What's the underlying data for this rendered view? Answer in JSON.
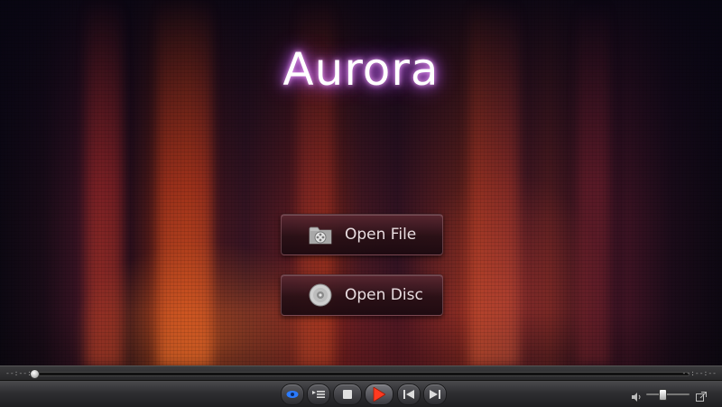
{
  "app": {
    "logo_text": "Aurora"
  },
  "main": {
    "open_file": {
      "label": "Open File",
      "icon": "folder-film-icon"
    },
    "open_disc": {
      "label": "Open Disc",
      "icon": "disc-icon"
    }
  },
  "seekbar": {
    "time_elapsed": "--:--:--",
    "time_total": "--:--:--",
    "progress": 0
  },
  "controls": {
    "eye_icon": "eye-icon",
    "playlist_icon": "playlist-icon",
    "stop_icon": "stop-icon",
    "play_icon": "play-icon",
    "prev_icon": "previous-icon",
    "next_icon": "next-icon",
    "volume_icon": "volume-icon",
    "volume_level": 0.35,
    "popout_icon": "popout-icon"
  },
  "colors": {
    "logo_glow": "#d36cff",
    "play_red": "#ff3a20",
    "eye_blue": "#2a7bff"
  }
}
